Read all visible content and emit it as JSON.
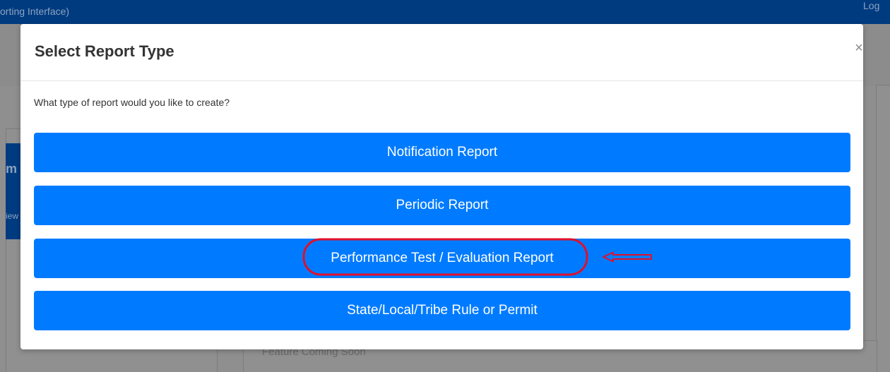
{
  "app": {
    "title_fragment": "orting Interface)",
    "logout_fragment": "Log",
    "bg_fragment_1": "m",
    "bg_fragment_2": "iew",
    "coming_soon": "Feature Coming Soon"
  },
  "modal": {
    "title": "Select Report Type",
    "close_label": "×",
    "prompt": "What type of report would you like to create?",
    "buttons": [
      {
        "label": "Notification Report"
      },
      {
        "label": "Periodic Report"
      },
      {
        "label": "Performance Test / Evaluation Report"
      },
      {
        "label": "State/Local/Tribe Rule or Permit"
      }
    ]
  },
  "annotation": {
    "color": "#e0102b"
  },
  "colors": {
    "primary_button": "#007bff",
    "header_bar": "#003b80",
    "overlay": "#8f8f8f"
  }
}
